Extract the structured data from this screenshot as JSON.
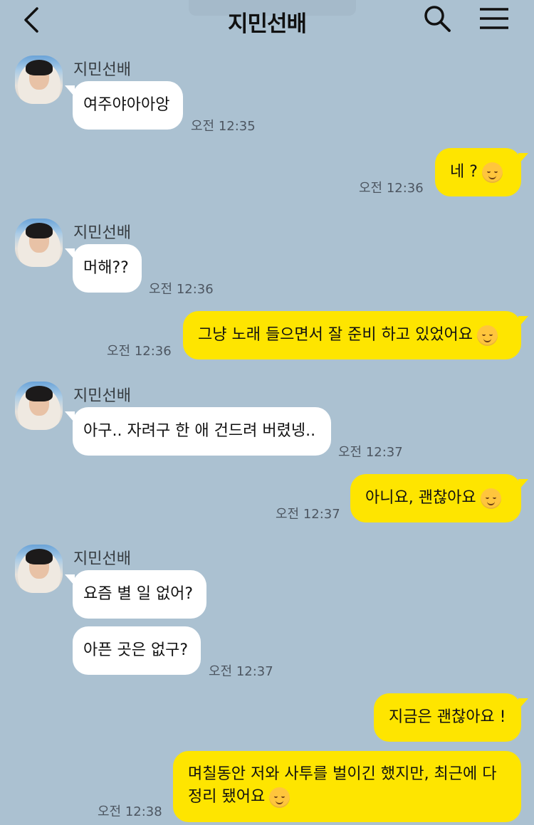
{
  "header": {
    "title": "지민선배",
    "back_icon": "chevron-left-icon",
    "search_icon": "search-icon",
    "menu_icon": "hamburger-menu-icon"
  },
  "colors": {
    "background": "#abc1d1",
    "incoming_bubble": "#ffffff",
    "outgoing_bubble": "#fee500"
  },
  "messages": [
    {
      "sender": "지민선배",
      "text": "여주야아아앙",
      "time": "오전 12:35"
    },
    {
      "text": "네 ?",
      "emoji": "relieved-face-emoji",
      "time": "오전 12:36"
    },
    {
      "sender": "지민선배",
      "text": "머해??",
      "time": "오전 12:36"
    },
    {
      "text": "그냥 노래 들으면서 잘 준비 하고 있었어요",
      "emoji": "smiling-face-emoji",
      "time": "오전 12:36"
    },
    {
      "sender": "지민선배",
      "text": "아구.. 자려구 한 애 건드려 버렸넹..",
      "time": "오전 12:37"
    },
    {
      "text": "아니요, 괜찮아요",
      "emoji": "hugging-face-emoji",
      "time": "오전 12:37"
    },
    {
      "sender": "지민선배",
      "text": "요즘 별 일 없어?"
    },
    {
      "text": "아픈 곳은 없구?",
      "time": "오전 12:37"
    },
    {
      "text": "지금은 괜찮아요 !"
    },
    {
      "text": "며칠동안 저와 사투를 벌이긴 했지만, 최근에 다 정리 됐어요",
      "emoji": "grinning-squinting-face-emoji",
      "time": "오전 12:38"
    }
  ]
}
